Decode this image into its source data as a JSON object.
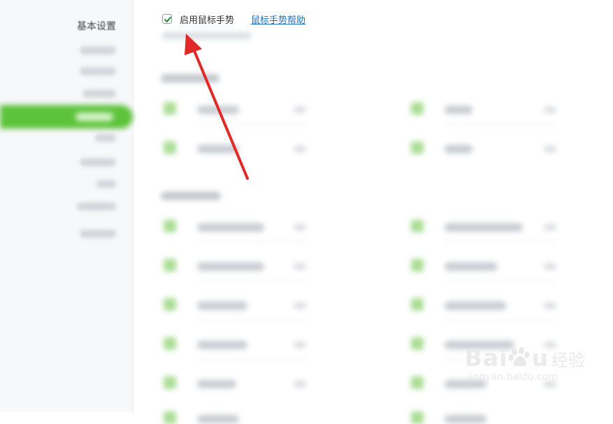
{
  "sidebar": {
    "title": "基本设置"
  },
  "toolbar": {
    "enable_label": "启用鼠标手势",
    "enable_checked": true,
    "help_link": "鼠标手势帮助"
  },
  "colors": {
    "accent": "#5cc33a",
    "link": "#1a73c8",
    "arrow": "#e02a2a"
  },
  "watermark": {
    "brand": "Bai",
    "brand_end": "u",
    "cn": "经验",
    "url": "jingyan.baidu.com"
  }
}
